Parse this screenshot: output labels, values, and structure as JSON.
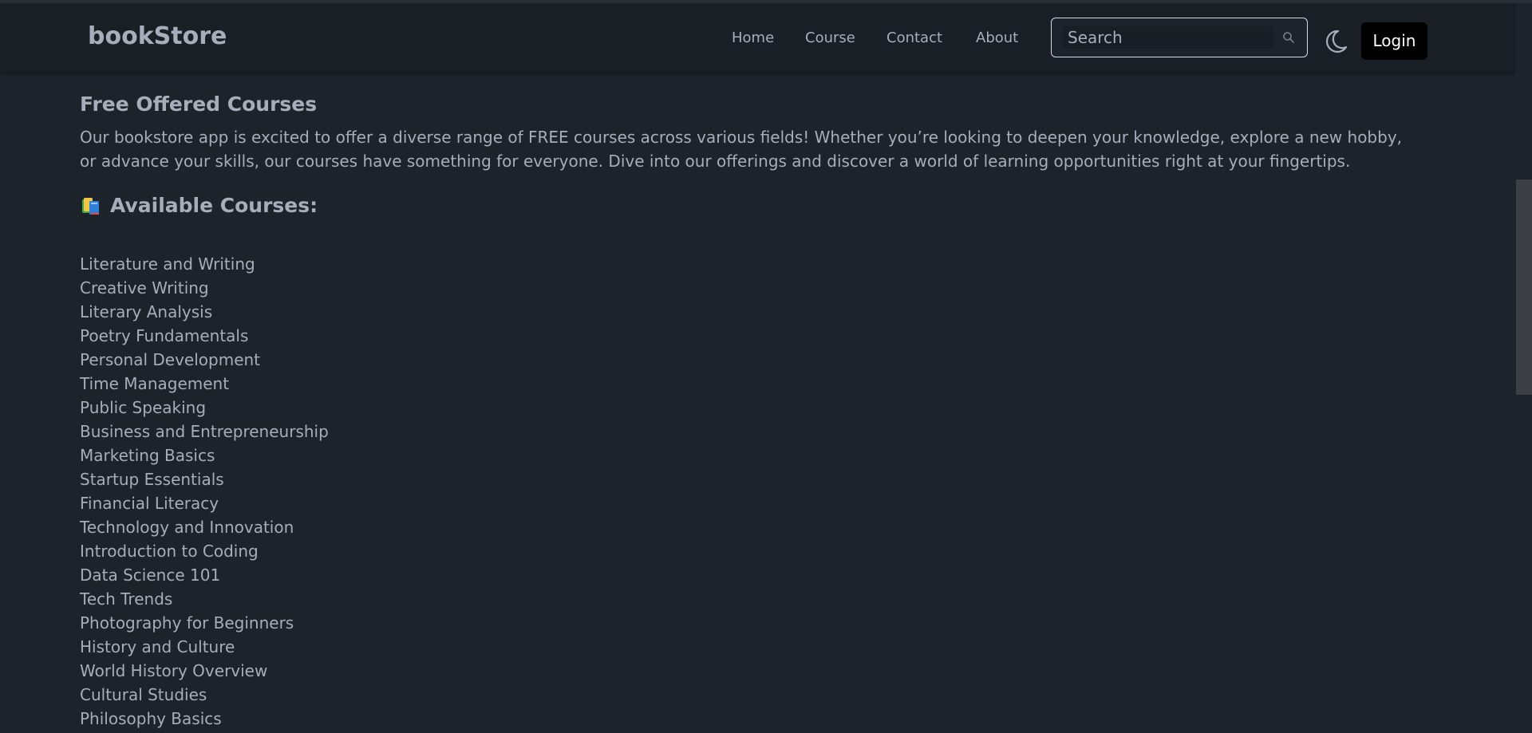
{
  "brand": "bookStore",
  "nav": {
    "links": [
      "Home",
      "Course",
      "Contact",
      "About"
    ]
  },
  "search": {
    "placeholder": "Search"
  },
  "login_label": "Login",
  "heading": "Free Offered Courses",
  "description": "Our bookstore app is excited to offer a diverse range of FREE courses across various fields! Whether you’re looking to deepen your knowledge, explore a new hobby, or advance your skills, our courses have something for everyone. Dive into our offerings and discover a world of learning opportunities right at your fingertips.",
  "available_heading": "Available Courses:",
  "icons": {
    "books": "books-emoji-icon",
    "search": "search-icon",
    "theme": "moon-icon"
  },
  "courses": [
    "Literature and Writing",
    "Creative Writing",
    "Literary Analysis",
    "Poetry Fundamentals",
    "Personal Development",
    "Time Management",
    "Public Speaking",
    "Business and Entrepreneurship",
    "Marketing Basics",
    "Startup Essentials",
    "Financial Literacy",
    "Technology and Innovation",
    "Introduction to Coding",
    "Data Science 101",
    "Tech Trends",
    "Photography for Beginners",
    "History and Culture",
    "World History Overview",
    "Cultural Studies",
    "Philosophy Basics"
  ],
  "colors": {
    "background": "#1d232a",
    "navbar": "#1a1f25",
    "text": "#a6adbb",
    "login_bg": "#000000"
  }
}
